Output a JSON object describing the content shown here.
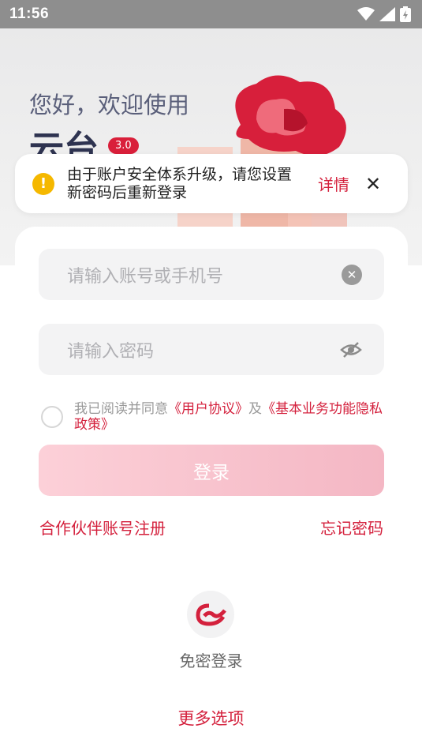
{
  "status_bar": {
    "time": "11:56",
    "icons": [
      "wifi-icon",
      "signal-icon",
      "battery-charging-icon"
    ]
  },
  "hero": {
    "greeting": "您好，欢迎使用",
    "app_name": "云台",
    "version": "3.0"
  },
  "notice": {
    "message": "由于账户安全体系升级，请您设置新密码后重新登录",
    "details_label": "详情",
    "close_icon": "close-icon"
  },
  "form": {
    "account_placeholder": "请输入账号或手机号",
    "password_placeholder": "请输入密码",
    "agreement": {
      "prefix": "我已阅读并同意",
      "user_agreement": "《用户协议》",
      "and": "及",
      "privacy_policy": "《基本业务功能隐私政策》"
    },
    "login_label": "登录",
    "partner_register": "合作伙伴账号注册",
    "forgot_password": "忘记密码"
  },
  "passwordless": {
    "label": "免密登录"
  },
  "more_options": "更多选项",
  "colors": {
    "accent": "#d4213d",
    "login_button": "#f6bcc8",
    "warning": "#f5b800"
  }
}
